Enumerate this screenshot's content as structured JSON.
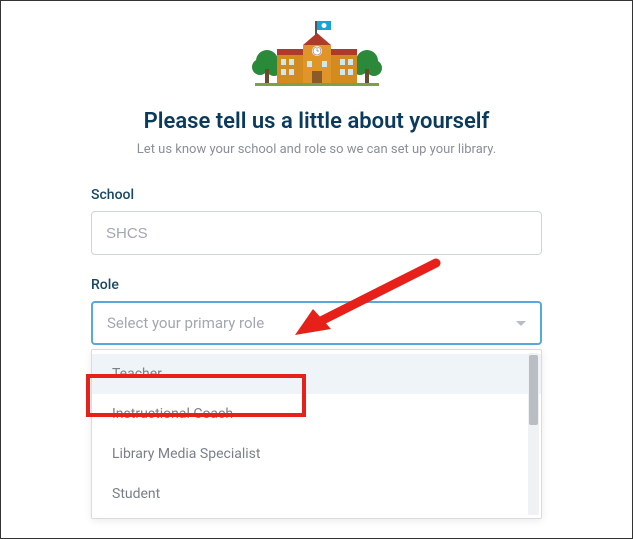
{
  "illustration": {
    "name": "school-building"
  },
  "heading": "Please tell us a little about yourself",
  "subheading": "Let us know your school and role so we can set up your library.",
  "fields": {
    "school": {
      "label": "School",
      "value": "SHCS"
    },
    "role": {
      "label": "Role",
      "placeholder": "Select your primary role",
      "options": [
        {
          "label": "Teacher",
          "highlighted": true
        },
        {
          "label": "Instructional Coach",
          "highlighted": false
        },
        {
          "label": "Library Media Specialist",
          "highlighted": false
        },
        {
          "label": "Student",
          "highlighted": false
        }
      ]
    }
  },
  "annotations": {
    "arrow_color": "#e8201a",
    "box_color": "#e8201a"
  }
}
